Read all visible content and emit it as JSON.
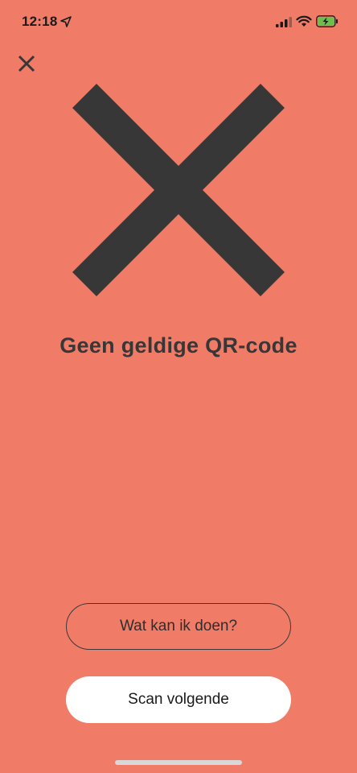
{
  "status_bar": {
    "time": "12:18",
    "location_icon": "location-arrow-icon",
    "signal_icon": "cellular-signal-icon",
    "wifi_icon": "wifi-icon",
    "battery_icon": "battery-charging-icon",
    "battery_color": "#6cc04a"
  },
  "header": {
    "close_icon": "close-icon"
  },
  "result": {
    "icon": "error-cross-icon",
    "title": "Geen geldige QR-code"
  },
  "actions": {
    "help_label": "Wat kan ik doen?",
    "scan_next_label": "Scan volgende"
  },
  "colors": {
    "background": "#F07C68",
    "foreground": "#373737",
    "button_solid": "#ffffff"
  }
}
